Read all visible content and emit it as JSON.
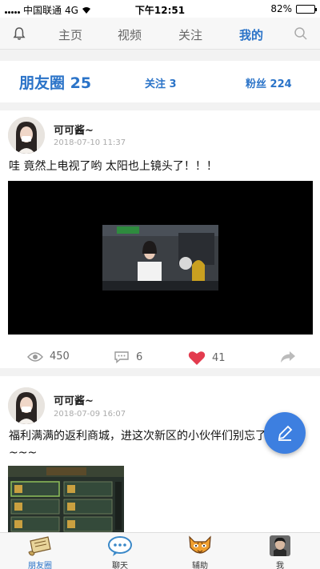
{
  "status_bar": {
    "carrier": "中国联通",
    "network": "4G",
    "time": "下午12:51",
    "battery": "82%",
    "battery_level": 0.82
  },
  "top_nav": {
    "tabs": [
      {
        "label": "主页"
      },
      {
        "label": "视频"
      },
      {
        "label": "关注"
      },
      {
        "label": "我的"
      }
    ],
    "active_tab": "我的"
  },
  "stats": {
    "moments": "朋友圈 25",
    "following": "关注 3",
    "fans": "粉丝 224"
  },
  "posts": [
    {
      "author": "可可酱~",
      "time": "2018-07-10 11:37",
      "text": "哇 竟然上电视了哟 太阳也上镜头了！！！",
      "views": "450",
      "comments": "6",
      "likes": "41"
    },
    {
      "author": "可可酱~",
      "time": "2018-07-09 16:07",
      "text": "福利满满的返利商城，进这次新区的小伙伴们别忘了看看哦~~~"
    }
  ],
  "bottom_nav": [
    {
      "label": "朋友圈",
      "icon": "scroll-icon"
    },
    {
      "label": "聊天",
      "icon": "chat-bubble-icon"
    },
    {
      "label": "辅助",
      "icon": "tiger-icon"
    },
    {
      "label": "我",
      "icon": "profile-avatar-icon"
    }
  ],
  "colors": {
    "accent": "#2a73c8",
    "like": "#e33b4e",
    "fab": "#3d7fe0"
  }
}
